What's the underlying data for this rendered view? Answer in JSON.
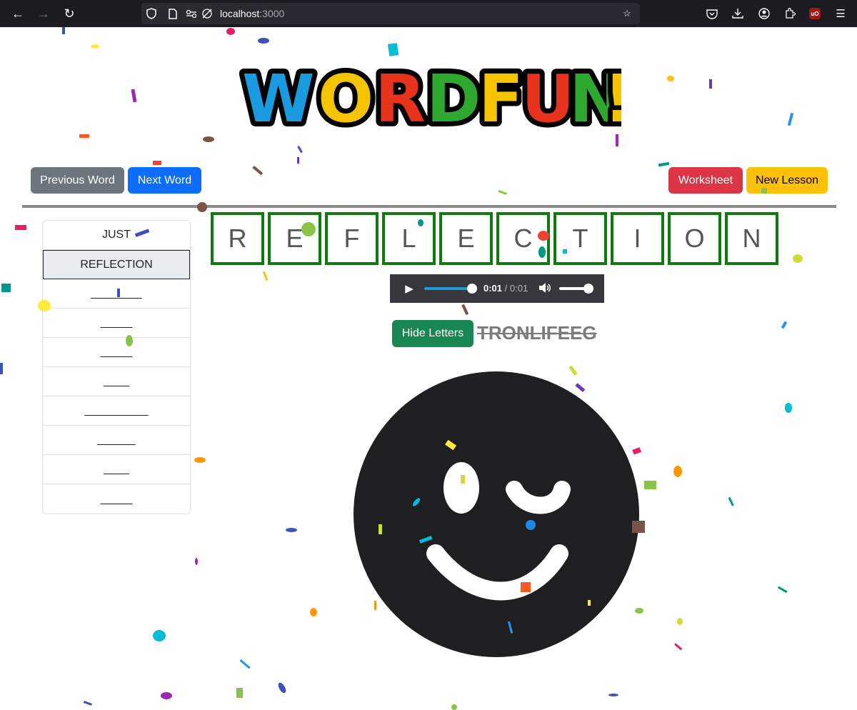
{
  "browser": {
    "url_host": "localhost",
    "url_port": ":3000"
  },
  "logo": {
    "text": "WORDFUN!"
  },
  "toolbar": {
    "previous_label": "Previous Word",
    "next_label": "Next Word",
    "worksheet_label": "Worksheet",
    "new_lesson_label": "New Lesson"
  },
  "word_list": [
    "JUST",
    "REFLECTION",
    "________",
    "_____",
    "_____",
    "____",
    "__________",
    "______",
    "____",
    "_____"
  ],
  "current_word": [
    "R",
    "E",
    "F",
    "L",
    "E",
    "C",
    "T",
    "I",
    "O",
    "N"
  ],
  "audio": {
    "current": "0:01",
    "separator": " / ",
    "duration": "0:01",
    "progress": 1.0,
    "volume": 0.85
  },
  "hide_letters_label": "Hide Letters",
  "scrambled": "TRONLIFEEG",
  "colors": {
    "secondary": "#6c757d",
    "primary": "#0d6efd",
    "danger": "#dc3545",
    "warning": "#ffc107",
    "success": "#198754",
    "letter_border": "#107a10"
  }
}
